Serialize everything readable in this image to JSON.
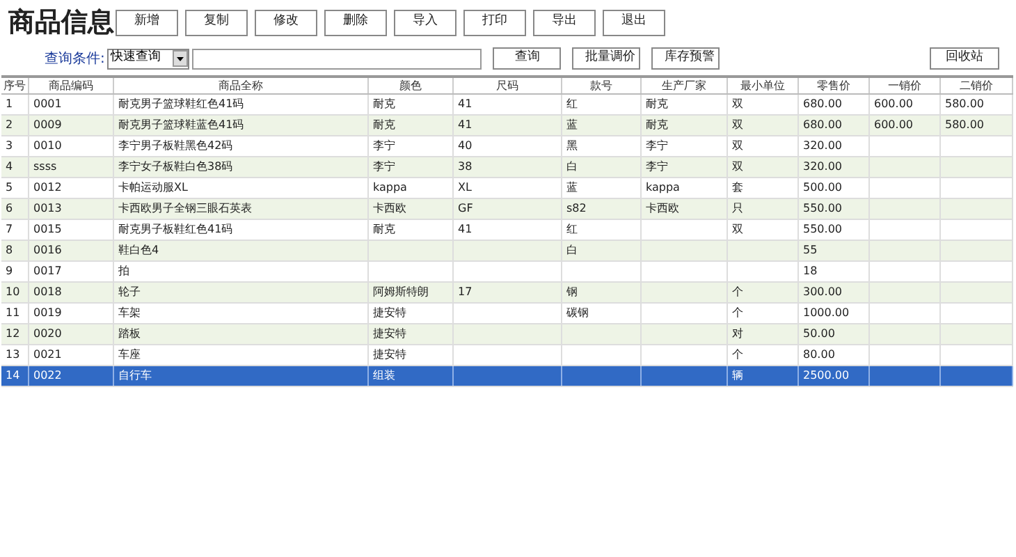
{
  "title": "商品信息",
  "toolbar": [
    "新增",
    "复制",
    "修改",
    "删除",
    "导入",
    "打印",
    "导出",
    "退出"
  ],
  "query": {
    "label": "查询条件:",
    "mode": "快速查询"
  },
  "actions": [
    {
      "kind": "left",
      "label": "查询"
    },
    {
      "kind": "left",
      "label": "批量调价"
    },
    {
      "kind": "left",
      "label": "库存预警"
    },
    {
      "kind": "right",
      "label": "回收站"
    }
  ],
  "table": {
    "columns": [
      "序号",
      "商品编码",
      "商品全称",
      "颜色",
      "尺码",
      "款号",
      "生产厂家",
      "最小单位",
      "零售价",
      "一销价",
      "二销价"
    ],
    "rows": [
      {
        "selected": false,
        "cells": [
          "1",
          "0001",
          "耐克男子篮球鞋红色41码",
          "耐克",
          "41",
          "红",
          "耐克",
          "双",
          "680.00",
          "600.00",
          "580.00"
        ]
      },
      {
        "selected": false,
        "cells": [
          "2",
          "0009",
          "耐克男子篮球鞋蓝色41码",
          "耐克",
          "41",
          "蓝",
          "耐克",
          "双",
          "680.00",
          "600.00",
          "580.00"
        ]
      },
      {
        "selected": false,
        "cells": [
          "3",
          "0010",
          "李宁男子板鞋黑色42码",
          "李宁",
          "40",
          "黑",
          "李宁",
          "双",
          "320.00",
          "",
          ""
        ]
      },
      {
        "selected": false,
        "cells": [
          "4",
          "ssss",
          "李宁女子板鞋白色38码",
          "李宁",
          "38",
          "白",
          "李宁",
          "双",
          "320.00",
          "",
          ""
        ]
      },
      {
        "selected": false,
        "cells": [
          "5",
          "0012",
          "卡帕运动服XL",
          "kappa",
          "XL",
          "蓝",
          "kappa",
          "套",
          "500.00",
          "",
          ""
        ]
      },
      {
        "selected": false,
        "cells": [
          "6",
          "0013",
          "卡西欧男子全钢三眼石英表",
          "卡西欧",
          "GF",
          "s82",
          "卡西欧",
          "只",
          "550.00",
          "",
          ""
        ]
      },
      {
        "selected": false,
        "cells": [
          "7",
          "0015",
          "耐克男子板鞋红色41码",
          "耐克",
          "41",
          "红",
          "",
          "双",
          "550.00",
          "",
          ""
        ]
      },
      {
        "selected": false,
        "cells": [
          "8",
          "0016",
          "鞋白色4",
          "",
          "",
          "白",
          "",
          "",
          "55",
          "",
          ""
        ]
      },
      {
        "selected": false,
        "cells": [
          "9",
          "0017",
          "拍",
          "",
          "",
          "",
          "",
          "",
          "18",
          "",
          ""
        ]
      },
      {
        "selected": false,
        "cells": [
          "10",
          "0018",
          "轮子",
          "阿姆斯特朗",
          "17",
          "钢",
          "",
          "个",
          "300.00",
          "",
          ""
        ]
      },
      {
        "selected": false,
        "cells": [
          "11",
          "0019",
          "车架",
          "捷安特",
          "",
          "碳钢",
          "",
          "个",
          "1000.00",
          "",
          ""
        ]
      },
      {
        "selected": false,
        "cells": [
          "12",
          "0020",
          "踏板",
          "捷安特",
          "",
          "",
          "",
          "对",
          "50.00",
          "",
          ""
        ]
      },
      {
        "selected": false,
        "cells": [
          "13",
          "0021",
          "车座",
          "捷安特",
          "",
          "",
          "",
          "个",
          "80.00",
          "",
          ""
        ]
      },
      {
        "selected": true,
        "cells": [
          "14",
          "0022",
          "自行车",
          "组装",
          "",
          "",
          "",
          "辆",
          "2500.00",
          "",
          ""
        ]
      }
    ]
  }
}
